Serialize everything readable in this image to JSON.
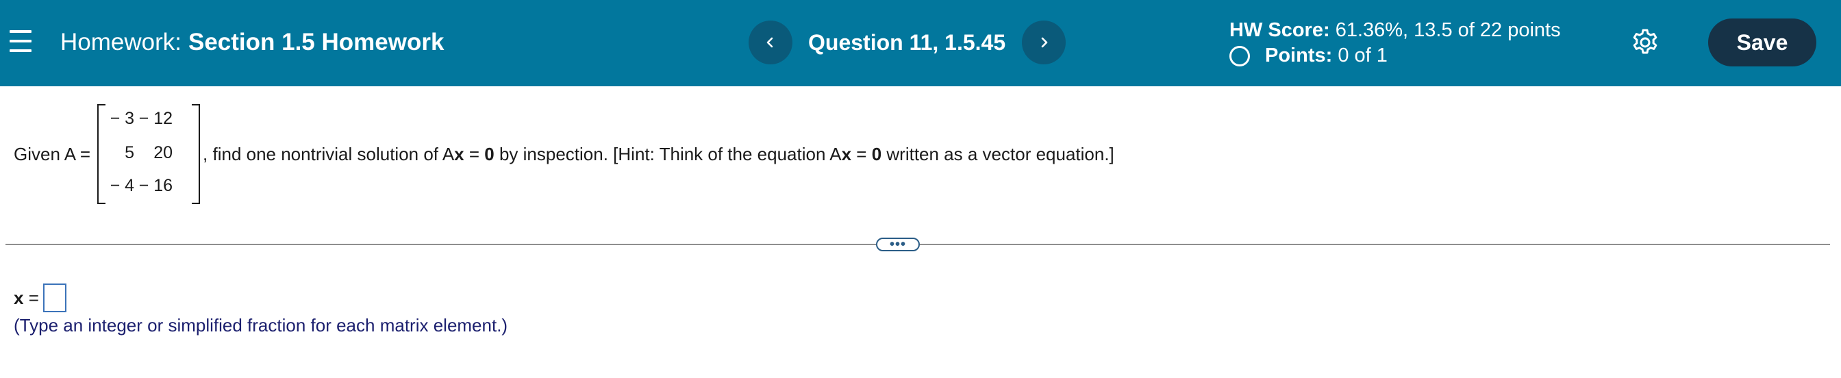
{
  "header": {
    "menu_icon": "hamburger-menu-icon",
    "homework_prefix": "Homework:",
    "homework_name": "Section 1.5 Homework",
    "question_label": "Question 11, 1.5.45",
    "prev_icon": "chevron-left-icon",
    "next_icon": "chevron-right-icon",
    "hw_score_label": "HW Score:",
    "hw_score_value": " 61.36%, 13.5 of 22 points",
    "points_label": "Points:",
    "points_value": " 0 of 1",
    "settings_icon": "gear-icon",
    "save_label": "Save",
    "colors": {
      "bar": "#02779d",
      "nav_button": "#0a5a7a",
      "save_button": "#163247"
    }
  },
  "question": {
    "given": "Given A =",
    "matrix": [
      [
        "− 3",
        "− 12"
      ],
      [
        "5",
        "20"
      ],
      [
        "− 4",
        "− 16"
      ]
    ],
    "text_1": ", find one nontrivial solution of A",
    "bold_x_1": "x",
    "text_2": " = ",
    "bold_0_1": "0",
    "text_3": " by inspection. [Hint: Think of the equation A",
    "bold_x_2": "x",
    "text_4": " = ",
    "bold_0_2": "0",
    "text_5": " written as a vector equation.]"
  },
  "divider": {
    "handle_icon": "ellipsis-icon",
    "handle_text": "•••"
  },
  "answer": {
    "x_label": "x",
    "equals": " =",
    "input_value": "",
    "hint": "(Type an integer or simplified fraction for each matrix element.)"
  }
}
